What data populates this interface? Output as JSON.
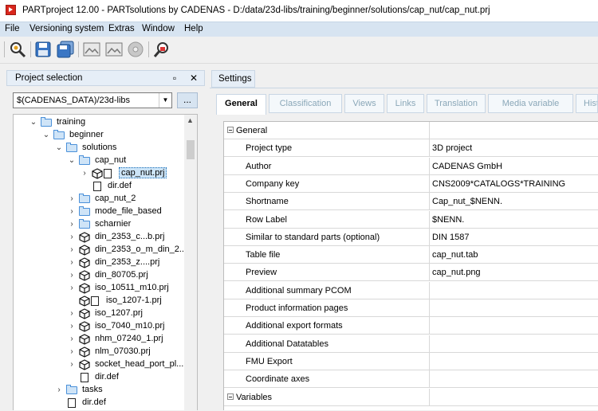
{
  "window": {
    "title": "PARTproject 12.00 - PARTsolutions by CADENAS - D:/data/23d-libs/training/beginner/solutions/cap_nut/cap_nut.prj"
  },
  "menu": [
    "File",
    "Versioning system",
    "Extras",
    "Window",
    "Help"
  ],
  "toolbar": {
    "icons": [
      "search-settings-icon",
      "save-icon",
      "save-all-icon",
      "image-icon",
      "image-icon",
      "disc-icon",
      "lock-search-icon"
    ]
  },
  "left_panel": {
    "title": "Project selection",
    "restore_glyph": "▫",
    "close_glyph": "✕",
    "path_value": "$(CADENAS_DATA)/23d-libs",
    "more_label": "...",
    "tree": [
      {
        "label": "training",
        "type": "folder",
        "level": 0,
        "expanded": true
      },
      {
        "label": "beginner",
        "type": "folder",
        "level": 1,
        "expanded": true
      },
      {
        "label": "solutions",
        "type": "folder",
        "level": 2,
        "expanded": true
      },
      {
        "label": "cap_nut",
        "type": "folder",
        "level": 3,
        "expanded": true
      },
      {
        "label": "cap_nut.prj",
        "type": "project",
        "level": 4,
        "expanded": false,
        "selected": true
      },
      {
        "label": "dir.def",
        "type": "file",
        "level": 4
      },
      {
        "label": "cap_nut_2",
        "type": "folder",
        "level": 3,
        "expanded": false
      },
      {
        "label": "mode_file_based",
        "type": "folder",
        "level": 3,
        "expanded": false
      },
      {
        "label": "scharnier",
        "type": "folder",
        "level": 3,
        "expanded": false
      },
      {
        "label": "din_2353_c...b.prj",
        "type": "project",
        "level": 3,
        "expanded": false
      },
      {
        "label": "din_2353_o_m_din_2...",
        "type": "project",
        "level": 3,
        "expanded": false
      },
      {
        "label": "din_2353_z....prj",
        "type": "project",
        "level": 3,
        "expanded": false
      },
      {
        "label": "din_80705.prj",
        "type": "project",
        "level": 3,
        "expanded": false
      },
      {
        "label": "iso_10511_m10.prj",
        "type": "project",
        "level": 3,
        "expanded": false
      },
      {
        "label": "iso_1207-1.prj",
        "type": "project",
        "level": 3,
        "nochevron": true
      },
      {
        "label": "iso_1207.prj",
        "type": "project",
        "level": 3,
        "expanded": false
      },
      {
        "label": "iso_7040_m10.prj",
        "type": "project",
        "level": 3,
        "expanded": false
      },
      {
        "label": "nhm_07240_1.prj",
        "type": "project",
        "level": 3,
        "expanded": false
      },
      {
        "label": "nlm_07030.prj",
        "type": "project",
        "level": 3,
        "expanded": false
      },
      {
        "label": "socket_head_port_pl...",
        "type": "project",
        "level": 3,
        "expanded": false
      },
      {
        "label": "dir.def",
        "type": "file",
        "level": 3
      },
      {
        "label": "tasks",
        "type": "folder",
        "level": 2,
        "expanded": false
      },
      {
        "label": "dir.def",
        "type": "file",
        "level": 2
      }
    ]
  },
  "right_panel": {
    "tab": "Settings",
    "subtabs": [
      "General",
      "Classification",
      "Views",
      "Links",
      "Translation",
      "Media variable",
      "Hist"
    ],
    "sections": [
      {
        "name": "General",
        "rows": [
          {
            "key": "Project type",
            "value": "3D project"
          },
          {
            "key": "Author",
            "value": "CADENAS GmbH"
          },
          {
            "key": "Company key",
            "value": "CNS2009*CATALOGS*TRAINING"
          },
          {
            "key": "Shortname",
            "value": "Cap_nut_$NENN."
          },
          {
            "key": "Row Label",
            "value": "$NENN."
          },
          {
            "key": "Similar to standard parts (optional)",
            "value": "DIN 1587"
          },
          {
            "key": "Table file",
            "value": "cap_nut.tab"
          },
          {
            "key": "Preview",
            "value": "cap_nut.png"
          },
          {
            "key": "Additional summary PCOM",
            "value": ""
          },
          {
            "key": "Product information pages",
            "value": ""
          },
          {
            "key": "Additional export formats",
            "value": ""
          },
          {
            "key": "Additional Datatables",
            "value": ""
          },
          {
            "key": "FMU Export",
            "value": ""
          },
          {
            "key": "Coordinate axes",
            "value": ""
          }
        ]
      },
      {
        "name": "Variables",
        "rows": []
      }
    ]
  }
}
